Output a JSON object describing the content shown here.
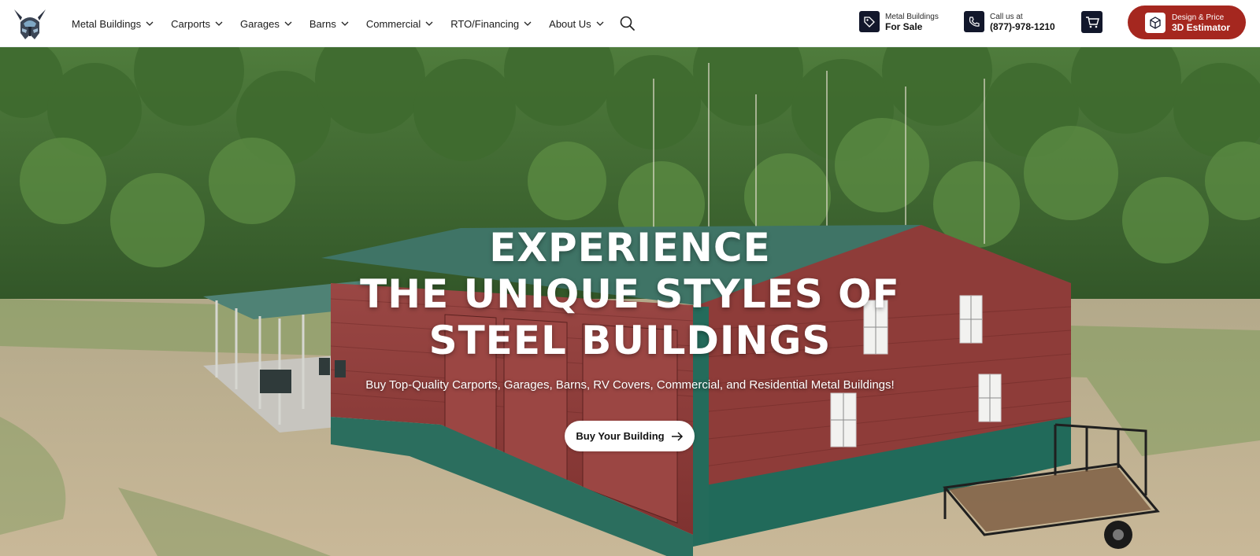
{
  "nav": {
    "items": [
      {
        "label": "Metal Buildings"
      },
      {
        "label": "Carports"
      },
      {
        "label": "Garages"
      },
      {
        "label": "Barns"
      },
      {
        "label": "Commercial"
      },
      {
        "label": "RTO/Financing"
      },
      {
        "label": "About Us"
      }
    ]
  },
  "header": {
    "for_sale_small": "Metal Buildings",
    "for_sale_bold": "For Sale",
    "call_small": "Call us at",
    "call_number": "(877)-978-1210",
    "estimator_small": "Design & Price",
    "estimator_bold": "3D Estimator"
  },
  "hero": {
    "title_line1": "EXPERIENCE",
    "title_line2": "THE UNIQUE STYLES OF",
    "title_line3": "STEEL BUILDINGS",
    "subtitle": "Buy Top-Quality Carports, Garages, Barns, RV Covers, Commercial, and Residential Metal Buildings!",
    "cta_label": "Buy Your Building"
  },
  "icons": {
    "logo": "viking-helmet-logo",
    "nav_chevron": "chevron-down-icon",
    "search": "search-icon",
    "for_sale": "price-tag-icon",
    "call": "phone-icon",
    "cart": "cart-icon",
    "estimator": "cube-icon",
    "cta_arrow": "arrow-right-icon"
  },
  "colors": {
    "brand_red": "#a5271f",
    "header_icon_bg": "#12172b",
    "building_red": "#8b3a37",
    "building_teal": "#1f6b5c"
  }
}
